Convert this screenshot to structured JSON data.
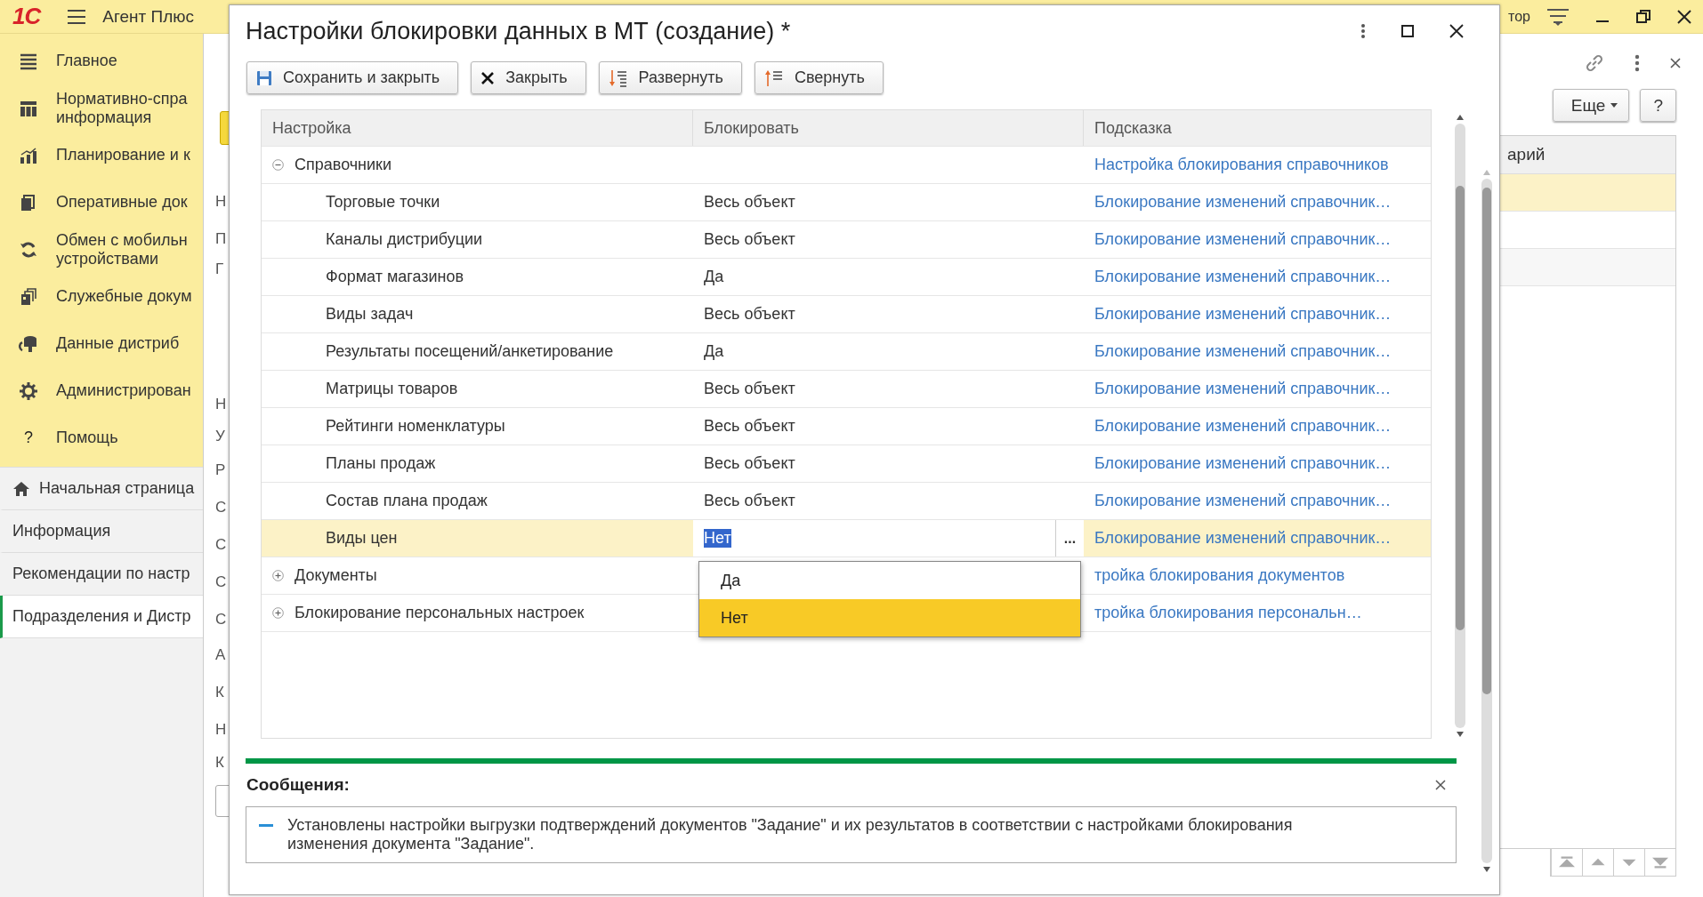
{
  "app": {
    "logo": "1С",
    "title": "Агент Плюс",
    "window_caption": "тор"
  },
  "sidebar": {
    "sections": [
      {
        "lines": [
          "Главное"
        ],
        "kind": "list"
      },
      {
        "lines": [
          "Нормативно-спра",
          "информация"
        ],
        "kind": "grid"
      },
      {
        "lines": [
          "Планирование и к"
        ],
        "kind": "chart"
      },
      {
        "lines": [
          "Оперативные док"
        ],
        "kind": "docs"
      },
      {
        "lines": [
          "Обмен с мобильн",
          "устройствами"
        ],
        "kind": "sync"
      },
      {
        "lines": [
          "Служебные докум"
        ],
        "kind": "docs2"
      },
      {
        "lines": [
          "Данные дистриб"
        ],
        "kind": "db"
      },
      {
        "lines": [
          "Администрирован"
        ],
        "kind": "gear"
      },
      {
        "lines": [
          "Помощь"
        ],
        "kind": "help",
        "glyph": "?"
      }
    ],
    "pages": [
      {
        "label": "Начальная страница",
        "kind": "home",
        "selected": false
      },
      {
        "label": "Информация",
        "kind": "plain",
        "selected": false
      },
      {
        "label": "Рекомендации по настр",
        "kind": "plain",
        "selected": false
      },
      {
        "label": "Подразделения и Дистр",
        "kind": "plain",
        "selected": true
      }
    ]
  },
  "background": {
    "labels": [
      "Н",
      "П",
      "Г",
      "Н",
      "У",
      "Р",
      "С",
      "С",
      "С",
      "С",
      "А",
      "К",
      "Н",
      "К"
    ],
    "more_button": "Еще",
    "help_button": "?",
    "table": {
      "column": "арий",
      "rows": [
        {
          "selected": true
        },
        {
          "selected": false
        },
        {
          "selected": false
        }
      ]
    }
  },
  "dialog": {
    "title": "Настройки блокировки данных в МТ (создание) *",
    "toolbar": [
      {
        "label": "Сохранить и закрыть",
        "kind": "save"
      },
      {
        "label": "Закрыть",
        "kind": "close"
      },
      {
        "label": "Развернуть",
        "kind": "expand"
      },
      {
        "label": "Свернуть",
        "kind": "collapse"
      }
    ],
    "table": {
      "columns": [
        "Настройка",
        "Блокировать",
        "Подсказка"
      ],
      "rows": [
        {
          "setting": "Справочники",
          "hint": "Настройка блокирования справочников",
          "expanded": true,
          "children": [
            {
              "setting": "Торговые точки",
              "block": "Весь объект",
              "hint": "Блокирование изменений справочник…",
              "selected": false
            },
            {
              "setting": "Каналы дистрибуции",
              "block": "Весь объект",
              "hint": "Блокирование изменений справочник…",
              "selected": false
            },
            {
              "setting": "Формат магазинов",
              "block": "Да",
              "hint": "Блокирование изменений справочник…",
              "selected": false
            },
            {
              "setting": "Виды задач",
              "block": "Весь объект",
              "hint": "Блокирование изменений справочник…",
              "selected": false
            },
            {
              "setting": "Результаты посещений/анкетирование",
              "block": "Да",
              "hint": "Блокирование изменений справочник…",
              "selected": false
            },
            {
              "setting": "Матрицы товаров",
              "block": "Весь объект",
              "hint": "Блокирование изменений справочник…",
              "selected": false
            },
            {
              "setting": "Рейтинги номенклатуры",
              "block": "Весь объект",
              "hint": "Блокирование изменений справочник…",
              "selected": false
            },
            {
              "setting": "Планы продаж",
              "block": "Весь объект",
              "hint": "Блокирование изменений справочник…",
              "selected": false
            },
            {
              "setting": "Состав плана продаж",
              "block": "Весь объект",
              "hint": "Блокирование изменений справочник…",
              "selected": false
            },
            {
              "setting": "Виды цен",
              "block": "Нет",
              "hint": "Блокирование изменений справочник…",
              "selected": true,
              "choice_button": "..."
            }
          ]
        },
        {
          "setting": "Документы",
          "hint": "тройка блокирования документов",
          "expanded": false
        },
        {
          "setting": "Блокирование персональных настроек",
          "hint": "тройка блокирования персональн…",
          "expanded": false
        }
      ],
      "dropdown": [
        {
          "label": "Да",
          "selected": false
        },
        {
          "label": "Нет",
          "selected": true
        }
      ]
    },
    "messages": {
      "title": "Сообщения:",
      "items": [
        "Установлены настройки выгрузки подтверждений документов \"Задание\" и их результатов в соответствии с настройками блокирования изменения документа \"Задание\"."
      ]
    }
  }
}
